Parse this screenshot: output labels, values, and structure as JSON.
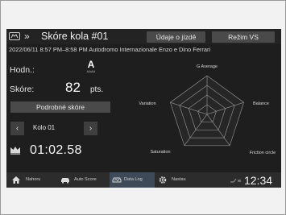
{
  "header": {
    "title": "Skóre kola #01",
    "chevrons": "»",
    "logo_icon": "honda-logo-icon",
    "button_udaje": "Údaje o jízdě",
    "button_rezim": "Režim VS"
  },
  "subtitle": "2022/06/11 8:57 PM–8:58 PM Autodromo Internazionale Enzo e Dino Ferrari",
  "rating": {
    "label": "Hodn.:",
    "grade": "A",
    "grade_sub": "AAAA"
  },
  "score": {
    "label": "Skóre:",
    "value": "82",
    "unit": "pts."
  },
  "detail_button": "Podrobné skóre",
  "lap": {
    "label": "Kolo 01",
    "prev_icon": "chevron-left-icon",
    "next_icon": "chevron-right-icon"
  },
  "best_time": {
    "icon": "crown-icon",
    "value": "01:02.58"
  },
  "radar": {
    "axes": [
      "G Average",
      "Balance",
      "Friction circle",
      "Saturation",
      "Variation"
    ],
    "rings": 4
  },
  "bottom_nav": {
    "items": [
      {
        "label": "Nahoru",
        "icon": "home-icon"
      },
      {
        "label": "Auto Score",
        "icon": "car-icon"
      },
      {
        "label": "Data Log",
        "icon": "datalog-icon"
      },
      {
        "label": "Nastav.",
        "icon": "gear-icon"
      }
    ],
    "active": "Data Log",
    "clock": "12:34"
  },
  "colors": {
    "background": "#1e1e1e",
    "button": "#4a4a4a",
    "active_tab": "#3e4a58",
    "text": "#ffffff"
  }
}
